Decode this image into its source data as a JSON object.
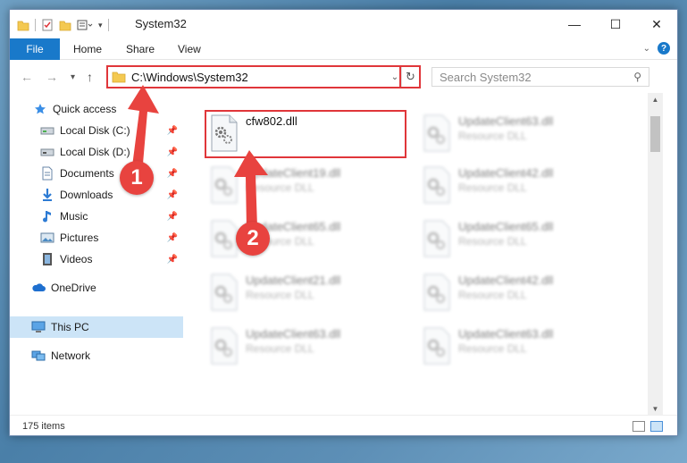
{
  "window": {
    "title": "System32"
  },
  "caption": {
    "minimize": "—",
    "maximize": "☐",
    "close": "✕"
  },
  "ribbon": {
    "file": "File",
    "home": "Home",
    "share": "Share",
    "view": "View"
  },
  "nav": {
    "back": "←",
    "forward": "→",
    "recent": "▾",
    "up": "↑",
    "address": "C:\\Windows\\System32",
    "search_placeholder": "Search System32"
  },
  "sidebar": {
    "items": [
      {
        "label": "Quick access",
        "icon": "star-icon",
        "pinned": false
      },
      {
        "label": "Local Disk (C:)",
        "icon": "drive-icon",
        "pinned": true
      },
      {
        "label": "Local Disk (D:)",
        "icon": "drive-icon",
        "pinned": true
      },
      {
        "label": "Documents",
        "icon": "documents-icon",
        "pinned": true
      },
      {
        "label": "Downloads",
        "icon": "download-icon",
        "pinned": true
      },
      {
        "label": "Music",
        "icon": "music-icon",
        "pinned": true
      },
      {
        "label": "Pictures",
        "icon": "pictures-icon",
        "pinned": true
      },
      {
        "label": "Videos",
        "icon": "videos-icon",
        "pinned": true
      },
      {
        "label": "OneDrive",
        "icon": "cloud-icon",
        "pinned": false
      },
      {
        "label": "This PC",
        "icon": "computer-icon",
        "pinned": false,
        "selected": true
      },
      {
        "label": "Network",
        "icon": "network-icon",
        "pinned": false
      }
    ]
  },
  "files": [
    {
      "name": "cfw802.dll",
      "type": "",
      "highlighted": true
    },
    {
      "name": "UpdateClient63.dll",
      "type": "Resource DLL"
    },
    {
      "name": "UpdateClient19.dll",
      "type": "Resource DLL"
    },
    {
      "name": "UpdateClient42.dll",
      "type": "Resource DLL"
    },
    {
      "name": "UpdateClient65.dll",
      "type": "Resource DLL"
    },
    {
      "name": "UpdateClient65.dll",
      "type": "Resource DLL"
    },
    {
      "name": "UpdateClient21.dll",
      "type": "Resource DLL"
    },
    {
      "name": "UpdateClient42.dll",
      "type": "Resource DLL"
    },
    {
      "name": "UpdateClient63.dll",
      "type": "Resource DLL"
    },
    {
      "name": "UpdateClient63.dll",
      "type": "Resource DLL"
    }
  ],
  "status": {
    "count": "175 items"
  },
  "annotations": {
    "step1": "1",
    "step2": "2",
    "color": "#e8433f"
  }
}
